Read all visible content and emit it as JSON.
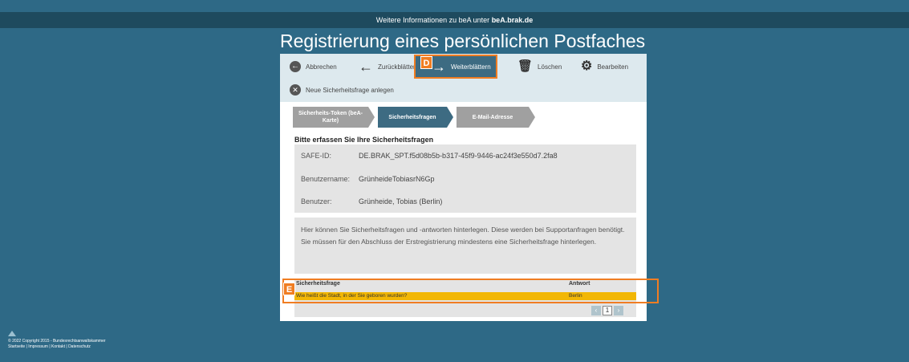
{
  "topbar": {
    "prefix": "Weitere Informationen zu beA unter ",
    "link": "beA.brak.de"
  },
  "page_title": "Registrierung eines persönlichen Postfaches",
  "toolbar": {
    "cancel": "Abbrechen",
    "back": "Zurückblättern",
    "forward": "Weiterblättern",
    "delete": "Löschen",
    "edit": "Bearbeiten",
    "new_question": "Neue Sicherheitsfrage anlegen"
  },
  "badges": {
    "d": "D",
    "e": "E"
  },
  "steps": [
    "Sicherheits-Token (beA-Karte)",
    "Sicherheitsfragen",
    "E-Mail-Adresse"
  ],
  "section_title": "Bitte erfassen Sie Ihre Sicherheitsfragen",
  "info": {
    "safe_id_label": "SAFE-ID:",
    "safe_id_value": "DE.BRAK_SPT.f5d08b5b-b317-45f9-9446-ac24f3e550d7.2fa8",
    "username_label": "Benutzername:",
    "username_value": "GrünheideTobiasrN6Gp",
    "user_label": "Benutzer:",
    "user_value": "Grünheide, Tobias (Berlin)"
  },
  "description": "Hier können Sie Sicherheitsfragen und -antworten hinterlegen. Diese werden bei Supportanfragen benötigt. Sie müssen für den Abschluss der Erstregistrierung mindestens eine Sicherheitsfrage hinterlegen.",
  "table": {
    "headers": [
      "Sicherheitsfrage",
      "Antwort"
    ],
    "rows": [
      {
        "question": "Wie heißt die Stadt, in der Sie geboren wurden?",
        "answer": "Berlin"
      }
    ]
  },
  "pager": {
    "prev": "‹",
    "page": "1",
    "next": "›"
  },
  "footer": {
    "copyright": "© 2022 Copyright 2015 - Bundesrechtsanwaltskammer",
    "links": [
      "Startseite",
      "Impressum",
      "Kontakt",
      "Datenschutz"
    ],
    "separator": " | "
  },
  "colors": {
    "background": "#2e6986",
    "accent": "#f07d22",
    "highlight_row": "#f2b705",
    "active_step": "#3d6b82"
  }
}
